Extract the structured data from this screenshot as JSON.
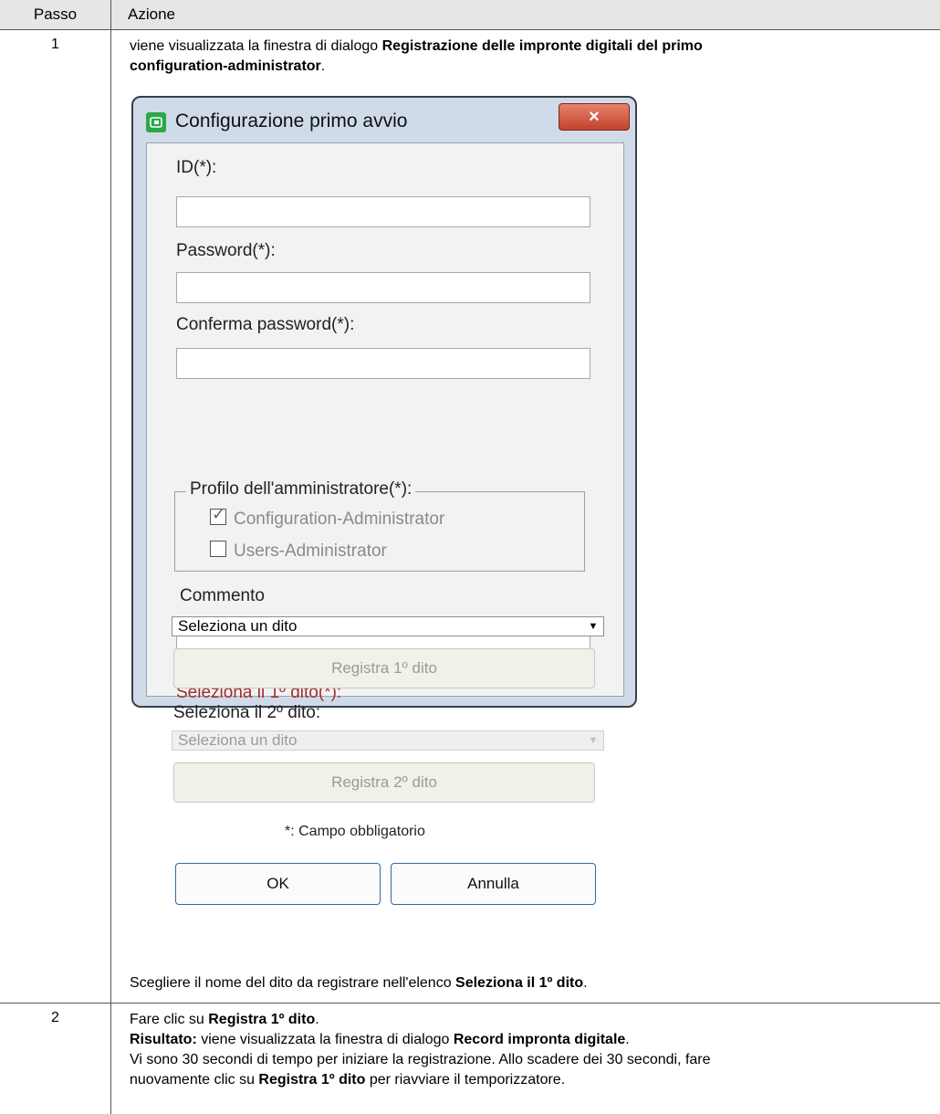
{
  "table": {
    "headers": {
      "step": "Passo",
      "action": "Azione"
    }
  },
  "step1": {
    "number": "1",
    "intro_prefix": "viene visualizzata la finestra di dialogo ",
    "intro_bold_line1": "Registrazione delle impronte digitali del primo",
    "intro_bold_line2": "configuration-administrator",
    "intro_suffix": ".",
    "outro_prefix": "Scegliere il nome del dito da registrare nell'elenco ",
    "outro_bold": "Seleziona il 1º dito",
    "outro_suffix": "."
  },
  "dialog": {
    "title": "Configurazione primo avvio",
    "close_label": "×",
    "id_label": "ID(*):",
    "id_value": "",
    "password_label": "Password(*):",
    "password_value": "",
    "confirm_label": "Conferma password(*):",
    "confirm_value": "",
    "profile_legend": "Profilo dell'amministratore(*):",
    "profiles": [
      {
        "label": "Configuration-Administrator",
        "checked": true
      },
      {
        "label": "Users-Administrator",
        "checked": false
      }
    ],
    "comment_label": "Commento",
    "comment_value": "",
    "finger1_label": "Seleziona il 1º dito(*):",
    "finger1_select": "Seleziona un dito",
    "record1_label": "Registra 1º dito",
    "finger2_label": "Seleziona il 2º dito:",
    "finger2_select": "Seleziona un dito",
    "record2_label": "Registra 2º dito",
    "required_note": "*: Campo obbligatorio",
    "ok_label": "OK",
    "cancel_label": "Annulla",
    "accent_red": "#a0302a"
  },
  "step2": {
    "number": "2",
    "line1_prefix": "Fare clic su ",
    "line1_bold": "Registra 1º dito",
    "line1_suffix": ".",
    "line2_bold": "Risultato:",
    "line2_text": " viene visualizzata la finestra di dialogo ",
    "line2_bold2": "Record impronta digitale",
    "line2_suffix": ".",
    "line3": "Vi sono 30 secondi di tempo per iniziare la registrazione. Allo scadere dei 30 secondi, fare",
    "line4_prefix": "nuovamente clic su ",
    "line4_bold": "Registra 1º dito",
    "line4_suffix": " per riavviare il temporizzatore."
  }
}
